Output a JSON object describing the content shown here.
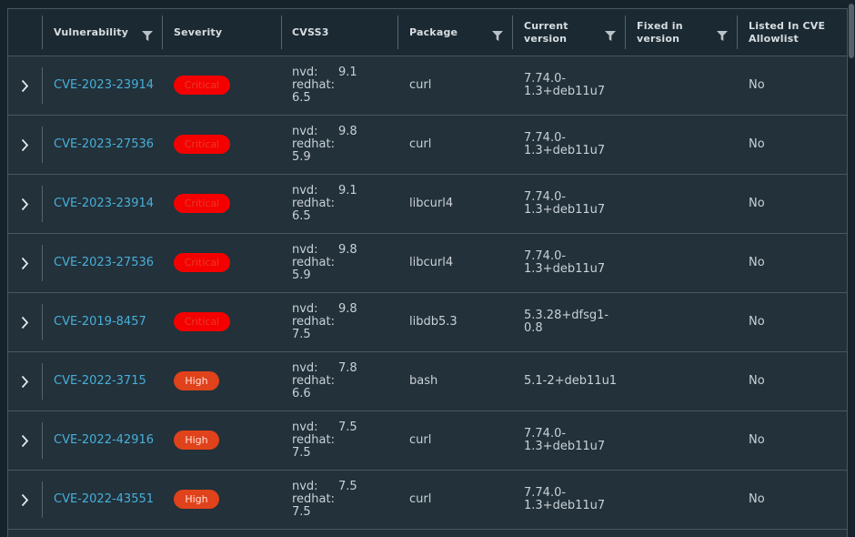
{
  "columns": {
    "vulnerability": "Vulnerability",
    "severity": "Severity",
    "cvss3": "CVSS3",
    "package": "Package",
    "current_version_line1": "Current",
    "current_version_line2": "version",
    "fixed_in_line1": "Fixed in",
    "fixed_in_line2": "version",
    "allowlist_line1": "Listed In CVE",
    "allowlist_line2": "Allowlist"
  },
  "colors": {
    "link": "#49afd9",
    "critical": "#f50000",
    "high": "#e0421b",
    "background": "#22313a"
  },
  "rows": [
    {
      "cve": "CVE-2023-23914",
      "severity": "Critical",
      "nvd_label": "nvd:",
      "nvd": "9.1",
      "redhat_label": "redhat:",
      "redhat": "6.5",
      "package": "curl",
      "version_line1": "7.74.0-",
      "version_line2": "1.3+deb11u7",
      "fixed": "",
      "allowlist": "No"
    },
    {
      "cve": "CVE-2023-27536",
      "severity": "Critical",
      "nvd_label": "nvd:",
      "nvd": "9.8",
      "redhat_label": "redhat:",
      "redhat": "5.9",
      "package": "curl",
      "version_line1": "7.74.0-",
      "version_line2": "1.3+deb11u7",
      "fixed": "",
      "allowlist": "No"
    },
    {
      "cve": "CVE-2023-23914",
      "severity": "Critical",
      "nvd_label": "nvd:",
      "nvd": "9.1",
      "redhat_label": "redhat:",
      "redhat": "6.5",
      "package": "libcurl4",
      "version_line1": "7.74.0-",
      "version_line2": "1.3+deb11u7",
      "fixed": "",
      "allowlist": "No"
    },
    {
      "cve": "CVE-2023-27536",
      "severity": "Critical",
      "nvd_label": "nvd:",
      "nvd": "9.8",
      "redhat_label": "redhat:",
      "redhat": "5.9",
      "package": "libcurl4",
      "version_line1": "7.74.0-",
      "version_line2": "1.3+deb11u7",
      "fixed": "",
      "allowlist": "No"
    },
    {
      "cve": "CVE-2019-8457",
      "severity": "Critical",
      "nvd_label": "nvd:",
      "nvd": "9.8",
      "redhat_label": "redhat:",
      "redhat": "7.5",
      "package": "libdb5.3",
      "version_line1": "5.3.28+dfsg1-",
      "version_line2": "0.8",
      "fixed": "",
      "allowlist": "No"
    },
    {
      "cve": "CVE-2022-3715",
      "severity": "High",
      "nvd_label": "nvd:",
      "nvd": "7.8",
      "redhat_label": "redhat:",
      "redhat": "6.6",
      "package": "bash",
      "version_line1": "5.1-2+deb11u1",
      "version_line2": "",
      "fixed": "",
      "allowlist": "No"
    },
    {
      "cve": "CVE-2022-42916",
      "severity": "High",
      "nvd_label": "nvd:",
      "nvd": "7.5",
      "redhat_label": "redhat:",
      "redhat": "7.5",
      "package": "curl",
      "version_line1": "7.74.0-",
      "version_line2": "1.3+deb11u7",
      "fixed": "",
      "allowlist": "No"
    },
    {
      "cve": "CVE-2022-43551",
      "severity": "High",
      "nvd_label": "nvd:",
      "nvd": "7.5",
      "redhat_label": "redhat:",
      "redhat": "7.5",
      "package": "curl",
      "version_line1": "7.74.0-",
      "version_line2": "1.3+deb11u7",
      "fixed": "",
      "allowlist": "No"
    }
  ]
}
